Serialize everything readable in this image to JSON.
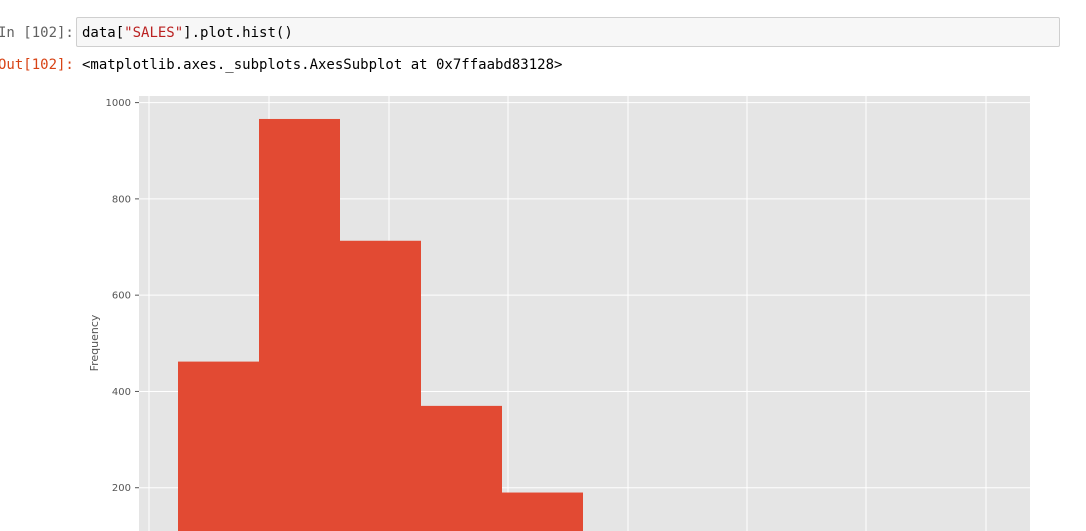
{
  "cell": {
    "in_prompt": "In [102]:",
    "code_prefix": "data[",
    "code_string": "\"SALES\"",
    "code_suffix": "].plot.hist()",
    "out_prompt": "Out[102]:",
    "output_text": "<matplotlib.axes._subplots.AxesSubplot at 0x7ffaabd83128>"
  },
  "colors": {
    "bar": "#e24a33",
    "plot_background": "#e5e5e5",
    "grid": "#ffffff",
    "tick_label": "#555555",
    "out_prompt": "#d84315",
    "code_string": "#ba2121"
  },
  "chart_data": {
    "type": "bar",
    "title": "",
    "xlabel": "",
    "ylabel": "Frequency",
    "ylim": [
      0,
      1000
    ],
    "yticks": [
      200,
      400,
      600,
      800,
      1000
    ],
    "grid": true,
    "style": "ggplot",
    "bin_index": [
      1,
      2,
      3,
      4,
      5
    ],
    "values": [
      462,
      966,
      713,
      370,
      190
    ]
  }
}
